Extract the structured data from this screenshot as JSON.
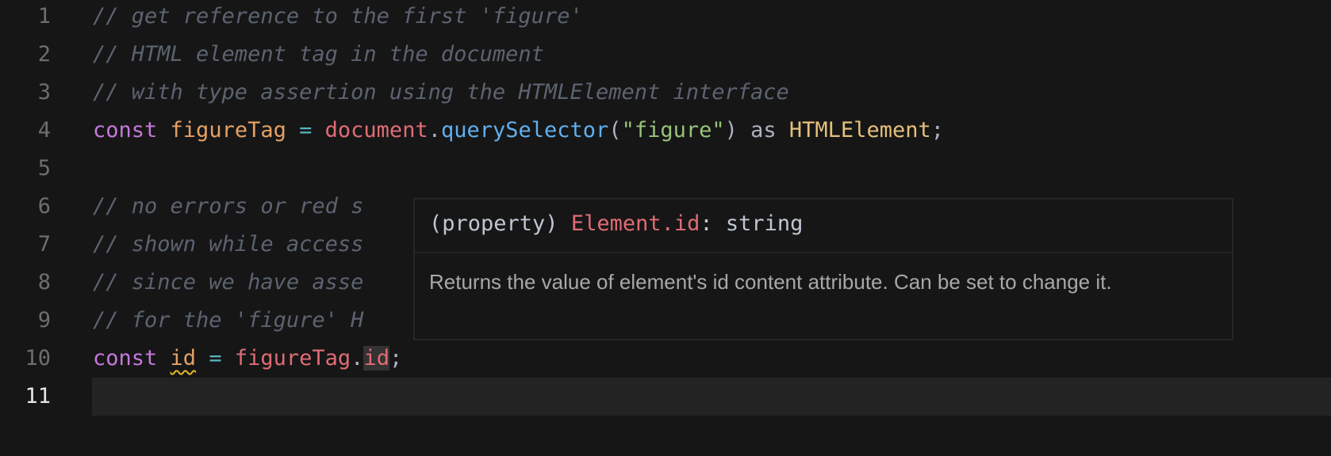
{
  "editor": {
    "current_line": 11,
    "lines": [
      {
        "number": "1",
        "tokens": [
          {
            "type": "cmt",
            "text": "// get reference to the first 'figure'"
          }
        ]
      },
      {
        "number": "2",
        "tokens": [
          {
            "type": "cmt",
            "text": "// HTML element tag in the document"
          }
        ]
      },
      {
        "number": "3",
        "tokens": [
          {
            "type": "cmt",
            "text": "// with type assertion using the HTMLElement interface"
          }
        ]
      },
      {
        "number": "4",
        "tokens": [
          {
            "type": "kw",
            "text": "const"
          },
          {
            "type": "plain",
            "text": " "
          },
          {
            "type": "var",
            "text": "figureTag"
          },
          {
            "type": "plain",
            "text": " "
          },
          {
            "type": "op",
            "text": "="
          },
          {
            "type": "plain",
            "text": " "
          },
          {
            "type": "obj",
            "text": "document"
          },
          {
            "type": "punc",
            "text": "."
          },
          {
            "type": "fn",
            "text": "querySelector"
          },
          {
            "type": "punc",
            "text": "("
          },
          {
            "type": "str",
            "text": "\"figure\""
          },
          {
            "type": "punc",
            "text": ")"
          },
          {
            "type": "plain",
            "text": " as "
          },
          {
            "type": "type",
            "text": "HTMLElement"
          },
          {
            "type": "punc",
            "text": ";"
          }
        ]
      },
      {
        "number": "5",
        "tokens": []
      },
      {
        "number": "6",
        "tokens": [
          {
            "type": "cmt",
            "text": "// no errors or red s"
          }
        ]
      },
      {
        "number": "7",
        "tokens": [
          {
            "type": "cmt",
            "text": "// shown while access"
          }
        ]
      },
      {
        "number": "8",
        "tokens": [
          {
            "type": "cmt",
            "text": "// since we have asse"
          }
        ]
      },
      {
        "number": "9",
        "tokens": [
          {
            "type": "cmt",
            "text": "// for the 'figure' H"
          }
        ]
      },
      {
        "number": "10",
        "tokens": [
          {
            "type": "kw",
            "text": "const"
          },
          {
            "type": "plain",
            "text": " "
          },
          {
            "type": "var squiggle",
            "text": "id"
          },
          {
            "type": "plain",
            "text": " "
          },
          {
            "type": "op",
            "text": "="
          },
          {
            "type": "plain",
            "text": " "
          },
          {
            "type": "obj",
            "text": "figureTag"
          },
          {
            "type": "punc",
            "text": "."
          },
          {
            "type": "obj hover-target",
            "text": "id"
          },
          {
            "type": "punc",
            "text": ";"
          }
        ]
      },
      {
        "number": "11",
        "tokens": []
      }
    ]
  },
  "hover_tooltip": {
    "kind": "(property) ",
    "name": "Element.id",
    "separator": ": ",
    "type": "string",
    "documentation": "Returns the value of element's id content attribute. Can be set to change it."
  },
  "colors": {
    "background": "#161616",
    "comment": "#5c6370",
    "keyword": "#c678dd",
    "variable": "#e5a165",
    "property": "#e06c75",
    "function": "#61afef",
    "string": "#98c379",
    "type": "#e5c07b",
    "warning_squiggle": "#e5b820"
  }
}
